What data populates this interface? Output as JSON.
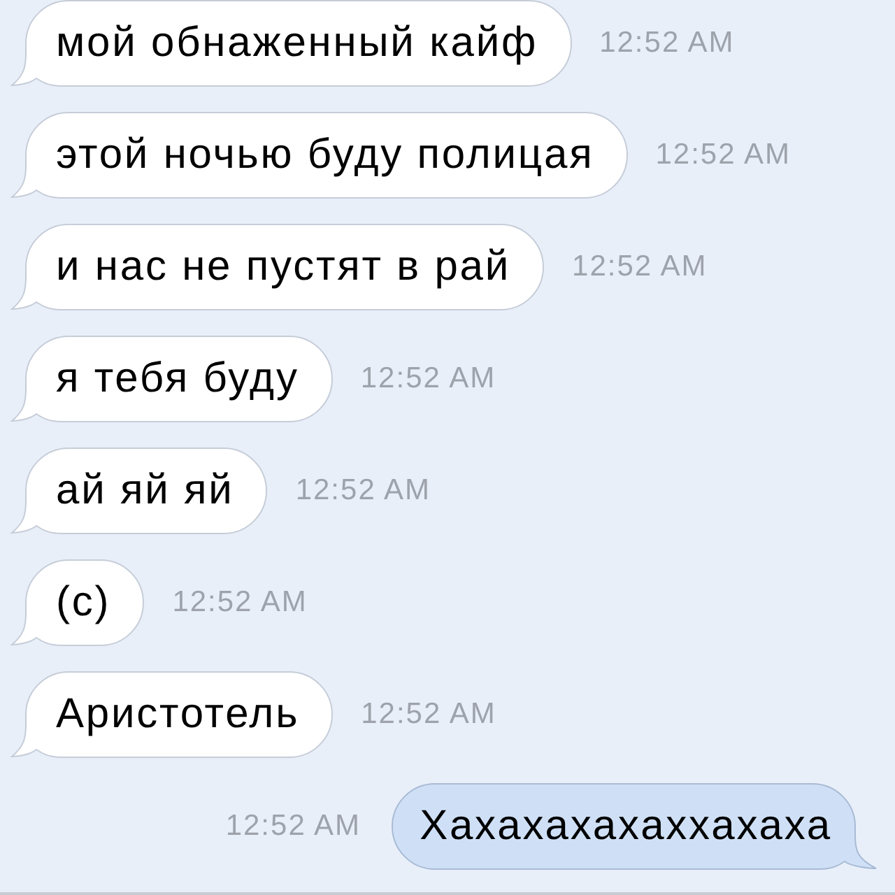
{
  "messages": [
    {
      "kind": "incoming",
      "text": "мой обнаженный кайф",
      "time": "12:52 AM"
    },
    {
      "kind": "incoming",
      "text": "этой ночью буду полицая",
      "time": "12:52 AM"
    },
    {
      "kind": "incoming",
      "text": "и нас не пустят в рай",
      "time": "12:52 AM"
    },
    {
      "kind": "incoming",
      "text": "я тебя буду",
      "time": "12:52 AM"
    },
    {
      "kind": "incoming",
      "text": "ай яй яй",
      "time": "12:52 AM"
    },
    {
      "kind": "incoming",
      "text": "(с)",
      "time": "12:52 AM"
    },
    {
      "kind": "incoming",
      "text": "Аристотель",
      "time": "12:52 AM"
    },
    {
      "kind": "outgoing",
      "text": "Хахахахахаххахаха",
      "time": "12:52 AM"
    }
  ]
}
